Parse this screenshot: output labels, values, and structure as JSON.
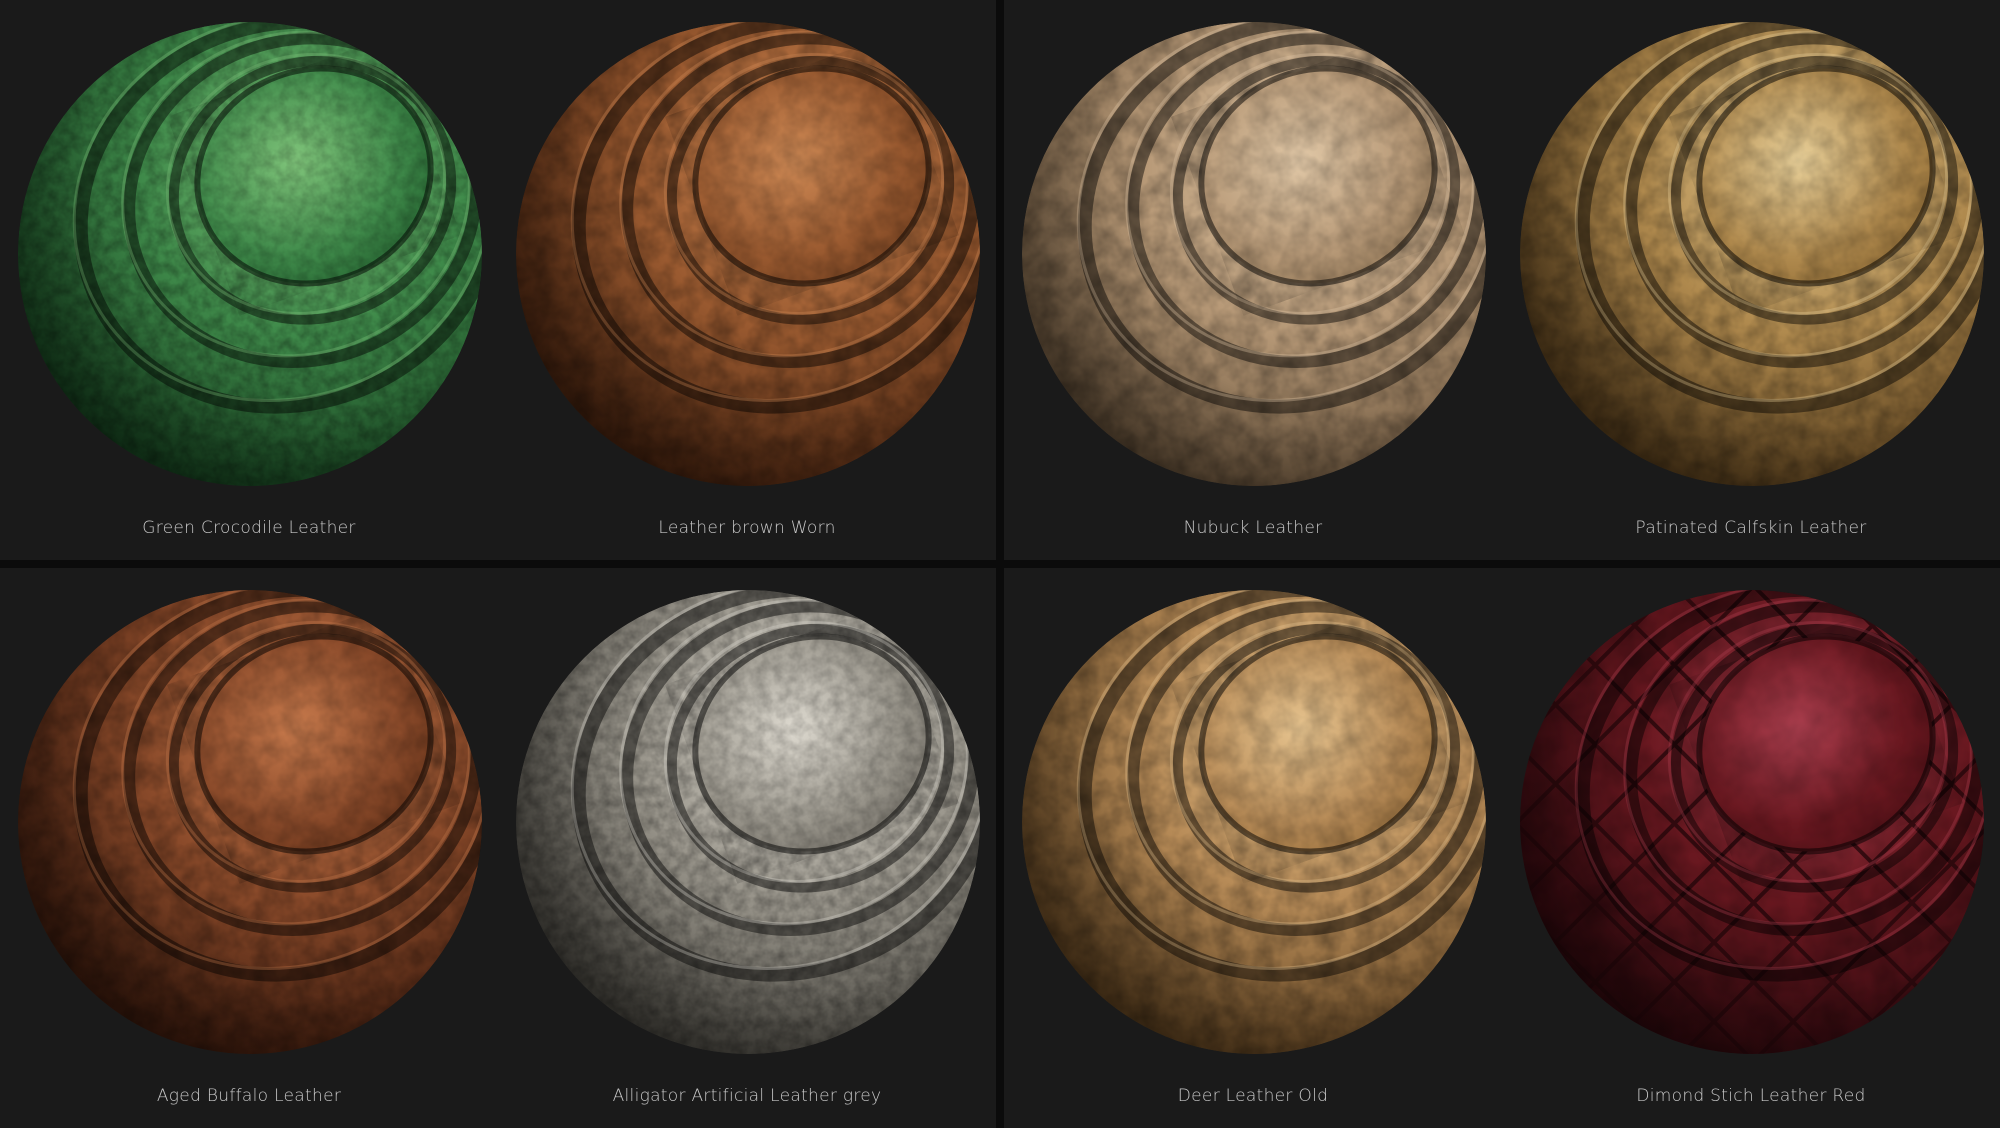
{
  "materials": [
    {
      "label": "Green Crocodile Leather",
      "base": "#3f8a4a",
      "light": "#7fc47a",
      "dark": "#0f3518",
      "rim": "#1e5a2a",
      "pattern": "scales"
    },
    {
      "label": "Leather brown Worn",
      "base": "#9a5a30",
      "light": "#d08a55",
      "dark": "#3a1a0a",
      "rim": "#6a3a1c",
      "pattern": "grain"
    },
    {
      "label": "Nubuck Leather",
      "base": "#b89a78",
      "light": "#e0c7a6",
      "dark": "#5a4630",
      "rim": "#8a7050",
      "pattern": "grain"
    },
    {
      "label": "Patinated Calfskin Leather",
      "base": "#b08a4e",
      "light": "#e8cf98",
      "dark": "#4a3214",
      "rim": "#8a6630",
      "pattern": "grain"
    },
    {
      "label": "Aged Buffalo Leather",
      "base": "#8a4a2a",
      "light": "#c87a4c",
      "dark": "#2e1208",
      "rim": "#5e2e16",
      "pattern": "grain"
    },
    {
      "label": "Alligator Artificial Leather grey",
      "base": "#9a968c",
      "light": "#dedad0",
      "dark": "#3a3832",
      "rim": "#6c6860",
      "pattern": "scales"
    },
    {
      "label": "Deer Leather Old",
      "base": "#b88c58",
      "light": "#e6c38e",
      "dark": "#4e3416",
      "rim": "#8e6634",
      "pattern": "grain"
    },
    {
      "label": "Dimond Stich Leather Red",
      "base": "#6a1820",
      "light": "#b04050",
      "dark": "#24060a",
      "rim": "#4a0e14",
      "pattern": "quilted"
    }
  ]
}
